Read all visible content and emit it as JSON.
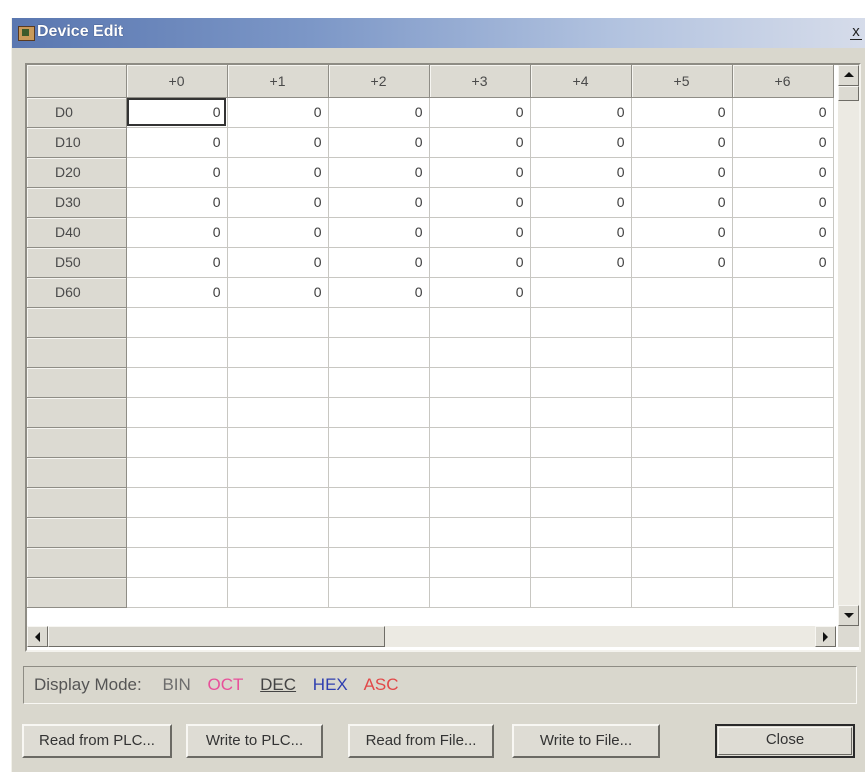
{
  "window": {
    "title": "Device Edit",
    "close_glyph": "x"
  },
  "grid": {
    "corner": "",
    "columns": [
      "+0",
      "+1",
      "+2",
      "+3",
      "+4",
      "+5",
      "+6"
    ],
    "rows": [
      {
        "label": "D0",
        "values": [
          "0",
          "0",
          "0",
          "0",
          "0",
          "0",
          "0"
        ]
      },
      {
        "label": "D10",
        "values": [
          "0",
          "0",
          "0",
          "0",
          "0",
          "0",
          "0"
        ]
      },
      {
        "label": "D20",
        "values": [
          "0",
          "0",
          "0",
          "0",
          "0",
          "0",
          "0"
        ]
      },
      {
        "label": "D30",
        "values": [
          "0",
          "0",
          "0",
          "0",
          "0",
          "0",
          "0"
        ]
      },
      {
        "label": "D40",
        "values": [
          "0",
          "0",
          "0",
          "0",
          "0",
          "0",
          "0"
        ]
      },
      {
        "label": "D50",
        "values": [
          "0",
          "0",
          "0",
          "0",
          "0",
          "0",
          "0"
        ]
      },
      {
        "label": "D60",
        "values": [
          "0",
          "0",
          "0",
          "0",
          "",
          "",
          ""
        ]
      },
      {
        "label": "",
        "values": [
          "",
          "",
          "",
          "",
          "",
          "",
          ""
        ]
      },
      {
        "label": "",
        "values": [
          "",
          "",
          "",
          "",
          "",
          "",
          ""
        ]
      },
      {
        "label": "",
        "values": [
          "",
          "",
          "",
          "",
          "",
          "",
          ""
        ]
      },
      {
        "label": "",
        "values": [
          "",
          "",
          "",
          "",
          "",
          "",
          ""
        ]
      },
      {
        "label": "",
        "values": [
          "",
          "",
          "",
          "",
          "",
          "",
          ""
        ]
      },
      {
        "label": "",
        "values": [
          "",
          "",
          "",
          "",
          "",
          "",
          ""
        ]
      },
      {
        "label": "",
        "values": [
          "",
          "",
          "",
          "",
          "",
          "",
          ""
        ]
      },
      {
        "label": "",
        "values": [
          "",
          "",
          "",
          "",
          "",
          "",
          ""
        ]
      },
      {
        "label": "",
        "values": [
          "",
          "",
          "",
          "",
          "",
          "",
          ""
        ]
      },
      {
        "label": "",
        "values": [
          "",
          "",
          "",
          "",
          "",
          "",
          ""
        ]
      }
    ]
  },
  "display_mode": {
    "label": "Display Mode:",
    "modes": {
      "bin": "BIN",
      "oct": "OCT",
      "dec": "DEC",
      "hex": "HEX",
      "asc": "ASC"
    },
    "selected": "DEC"
  },
  "buttons": {
    "read_plc": "Read from PLC...",
    "write_plc": "Write to PLC...",
    "read_file": "Read from File...",
    "write_file": "Write to File...",
    "close": "Close"
  },
  "colors": {
    "title_gradient_start": "#5a77b0",
    "window_bg": "#d9d7cd",
    "oct": "#e8509a",
    "hex": "#2f3fb0",
    "asc": "#e24848"
  }
}
